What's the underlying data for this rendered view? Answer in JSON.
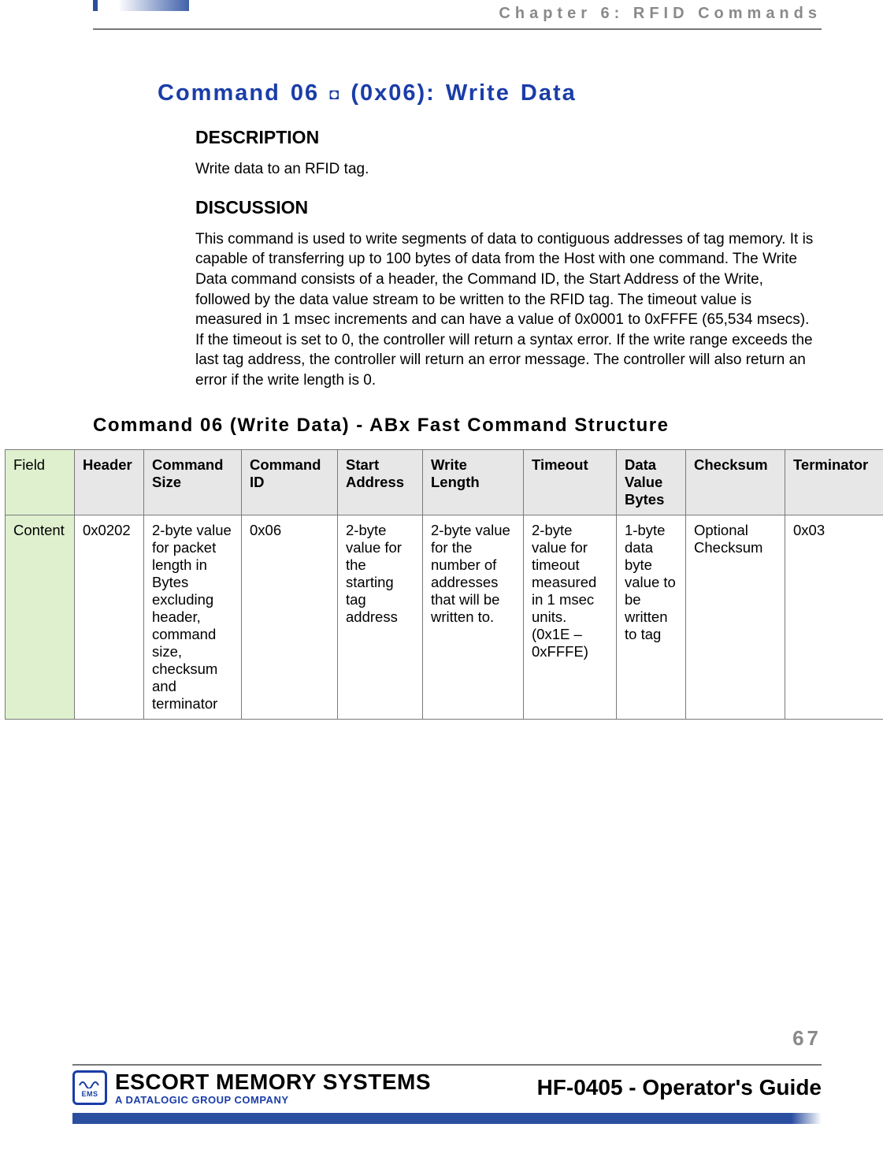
{
  "chapter_label": "Chapter 6: RFID Commands",
  "title_prefix": "Command 06 ",
  "title_glyph": "◘",
  "title_suffix": " (0x06): Write Data",
  "description_heading": "DESCRIPTION",
  "description_text": "Write data to an RFID tag.",
  "discussion_heading": "DISCUSSION",
  "discussion_text": "This command is used to write segments of data to contiguous addresses of tag memory. It is capable of transferring up to 100 bytes of data from the Host with one command. The Write Data command consists of a header, the Command ID, the Start Address of the Write, followed by the data value stream to be written to the RFID tag. The timeout value is measured in 1 msec increments and can have a value of 0x0001 to 0xFFFE (65,534 msecs). If the timeout is set to 0, the controller will return a syntax error. If the write range exceeds the last tag address, the controller will return an error message. The controller will also return an error if the write length is 0.",
  "structure_heading": "Command 06 (Write Data) - ABx Fast Command Structure",
  "table": {
    "row0_label": "Field",
    "headers": [
      "Header",
      "Command Size",
      "Command ID",
      "Start Address",
      "Write Length",
      "Timeout",
      "Data Value Bytes",
      "Checksum",
      "Terminator"
    ],
    "row1_label": "Content",
    "cells": [
      "0x0202",
      "2-byte value for packet length in Bytes excluding header, command size, checksum and terminator",
      "0x06",
      "2-byte value for the starting tag address",
      "2-byte value for the number of addresses that will be written to.",
      "2-byte value for timeout measured in 1 msec units. (0x1E – 0xFFFE)",
      "1-byte data byte value to be written to tag",
      "Optional Checksum",
      "0x03"
    ]
  },
  "page_number": "67",
  "footer": {
    "ems_badge_text": "EMS",
    "brand_main": "ESCORT MEMORY SYSTEMS",
    "brand_sub": "A DATALOGIC GROUP COMPANY",
    "guide_title": "HF-0405 - Operator's Guide"
  }
}
